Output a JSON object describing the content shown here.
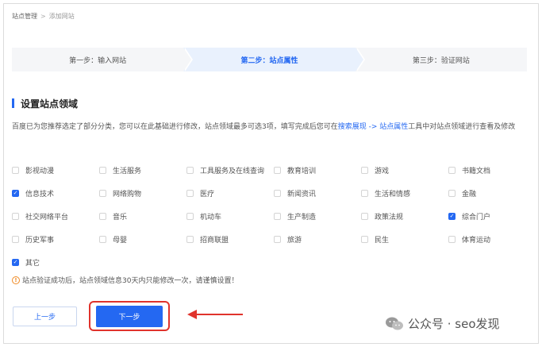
{
  "breadcrumb": {
    "root": "站点管理",
    "separator": ">",
    "current": "添加网站"
  },
  "steps": [
    {
      "label": "第一步：输入网站",
      "active": false
    },
    {
      "label": "第二步：站点属性",
      "active": true
    },
    {
      "label": "第三步：验证网站",
      "active": false
    }
  ],
  "section": {
    "title": "设置站点领域"
  },
  "description": {
    "part1": "百度已为您推荐选定了部分分类，您可以在此基础进行修改，站点领域最多可选3项，填写完成后您可在",
    "link1": "搜索展现",
    "arrow": " -> ",
    "link2": "站点属性",
    "part2": "工具中对站点领域进行查看及修改"
  },
  "categories": [
    [
      {
        "label": "影视动漫",
        "checked": false
      },
      {
        "label": "生活服务",
        "checked": false
      },
      {
        "label": "工具服务及在线查询",
        "checked": false
      },
      {
        "label": "教育培训",
        "checked": false
      },
      {
        "label": "游戏",
        "checked": false
      },
      {
        "label": "书籍文档",
        "checked": false
      }
    ],
    [
      {
        "label": "信息技术",
        "checked": true
      },
      {
        "label": "网络购物",
        "checked": false
      },
      {
        "label": "医疗",
        "checked": false
      },
      {
        "label": "新闻资讯",
        "checked": false
      },
      {
        "label": "生活和情感",
        "checked": false
      },
      {
        "label": "金融",
        "checked": false
      }
    ],
    [
      {
        "label": "社交网络平台",
        "checked": false
      },
      {
        "label": "音乐",
        "checked": false
      },
      {
        "label": "机动车",
        "checked": false
      },
      {
        "label": "生产制造",
        "checked": false
      },
      {
        "label": "政策法规",
        "checked": false
      },
      {
        "label": "综合门户",
        "checked": true
      }
    ],
    [
      {
        "label": "历史军事",
        "checked": false
      },
      {
        "label": "母婴",
        "checked": false
      },
      {
        "label": "招商联盟",
        "checked": false
      },
      {
        "label": "旅游",
        "checked": false
      },
      {
        "label": "民生",
        "checked": false
      },
      {
        "label": "体育运动",
        "checked": false
      }
    ],
    [
      {
        "label": "其它",
        "checked": true
      }
    ]
  ],
  "notice": {
    "icon": "!",
    "text": "站点验证成功后，站点领域信息30天内只能修改一次，请谨慎设置！"
  },
  "buttons": {
    "prev": "上一步",
    "next": "下一步"
  },
  "watermark": {
    "text": "公众号 · seo发现"
  },
  "colors": {
    "accent": "#2468f2",
    "highlight": "#e0332c",
    "warning": "#f08a24"
  }
}
